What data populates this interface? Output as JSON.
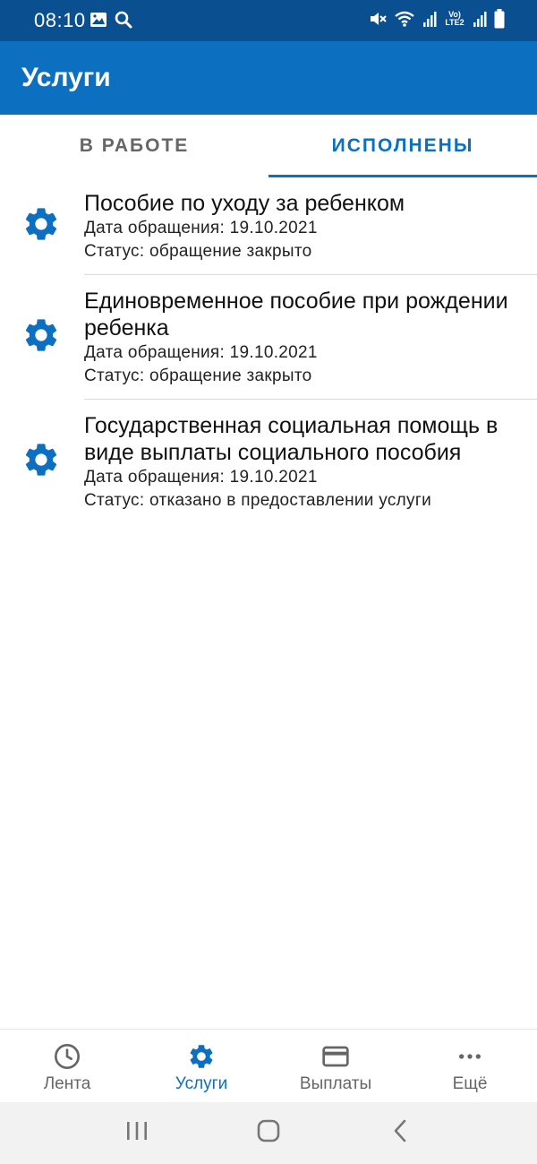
{
  "status_bar": {
    "time": "08:10",
    "icons_left": [
      "image-icon",
      "search-icon"
    ],
    "icons_right": [
      "mute-icon",
      "wifi-icon",
      "signal-icon",
      "volte-icon",
      "signal-icon",
      "battery-icon"
    ],
    "volte_text": "Vo) LTE2"
  },
  "app_bar": {
    "title": "Услуги"
  },
  "tabs": [
    {
      "label": "В РАБОТЕ",
      "active": false
    },
    {
      "label": "ИСПОЛНЕНЫ",
      "active": true
    }
  ],
  "services": [
    {
      "icon": "gear-icon",
      "title": "Пособие по уходу за ребенком",
      "date": "Дата обращения: 19.10.2021",
      "status": "Статус: обращение закрыто"
    },
    {
      "icon": "gear-icon",
      "title": "Единовременное пособие при рождении ребенка",
      "date": "Дата обращения: 19.10.2021",
      "status": "Статус: обращение закрыто"
    },
    {
      "icon": "gear-icon",
      "title": "Государственная социальная помощь в виде выплаты социального пособия",
      "date": "Дата обращения: 19.10.2021",
      "status": "Статус: отказано в предоставлении услуги"
    }
  ],
  "bottom_nav": [
    {
      "label": "Лента",
      "icon": "clock-icon",
      "active": false
    },
    {
      "label": "Услуги",
      "icon": "gear-icon",
      "active": true
    },
    {
      "label": "Выплаты",
      "icon": "card-icon",
      "active": false
    },
    {
      "label": "Ещё",
      "icon": "more-icon",
      "active": false
    }
  ],
  "colors": {
    "status_bar": "#0a4f8f",
    "primary": "#0d6fbf",
    "inactive": "#666666",
    "divider": "#dcdcdc"
  }
}
